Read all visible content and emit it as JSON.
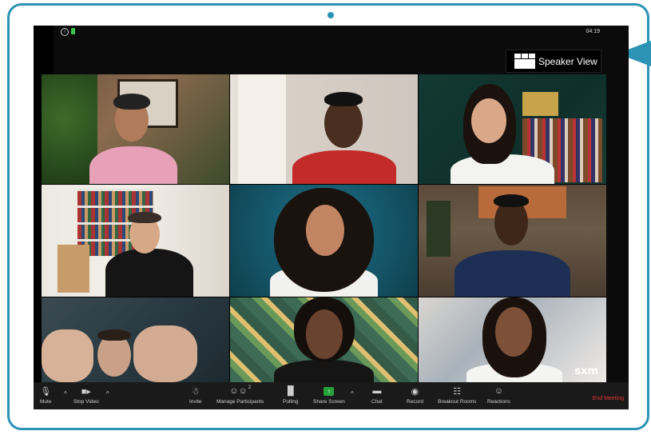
{
  "status_bar": {
    "time": "04:19",
    "info_glyph": "i"
  },
  "speaker_view": {
    "label": "Speaker View"
  },
  "watermark": {
    "text": "sxm"
  },
  "toolbar": {
    "mute": "Mute",
    "stop_video": "Stop Video",
    "invite": "Invite",
    "manage_participants": "Manage Participants",
    "participant_count": "2",
    "polling": "Polling",
    "share_screen": "Share Screen",
    "chat": "Chat",
    "record": "Record",
    "breakout_rooms": "Breakout Rooms",
    "reactions": "Reactions",
    "end_meeting": "End Meeting"
  },
  "colors": {
    "frame": "#2c93b5",
    "share_green": "#25a33a",
    "end_meeting": "#e0342e"
  }
}
